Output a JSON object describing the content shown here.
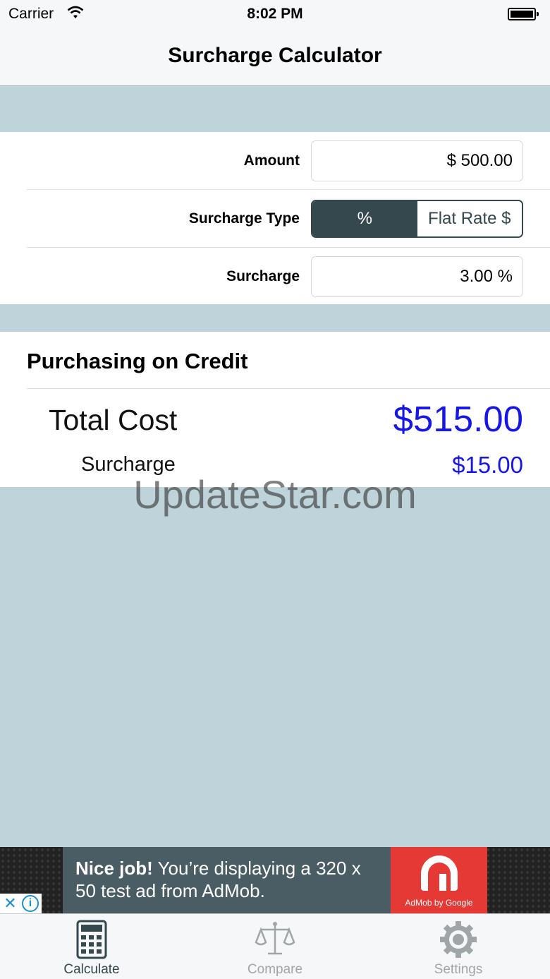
{
  "status_bar": {
    "carrier": "Carrier",
    "time": "8:02 PM"
  },
  "nav": {
    "title": "Surcharge Calculator"
  },
  "form": {
    "amount_label": "Amount",
    "amount_value": "$ 500.00",
    "surcharge_type_label": "Surcharge Type",
    "type_options": [
      "%",
      "Flat Rate $"
    ],
    "type_selected": "%",
    "surcharge_label": "Surcharge",
    "surcharge_value": "3.00 %"
  },
  "results": {
    "heading": "Purchasing on Credit",
    "total_label": "Total Cost",
    "total_value": "$515.00",
    "surcharge_label": "Surcharge",
    "surcharge_value": "$15.00"
  },
  "watermark": "UpdateStar.com",
  "ad": {
    "headline": "Nice job!",
    "body": "You’re displaying a 320 x 50 test ad from AdMob.",
    "logo_text": "AdMob by Google"
  },
  "tabs": [
    {
      "label": "Calculate",
      "icon": "calculator-icon",
      "active": true
    },
    {
      "label": "Compare",
      "icon": "scales-icon",
      "active": false
    },
    {
      "label": "Settings",
      "icon": "gear-icon",
      "active": false
    }
  ],
  "colors": {
    "accent": "#35484d",
    "result_blue": "#1616e8",
    "background": "#bfd3da"
  }
}
